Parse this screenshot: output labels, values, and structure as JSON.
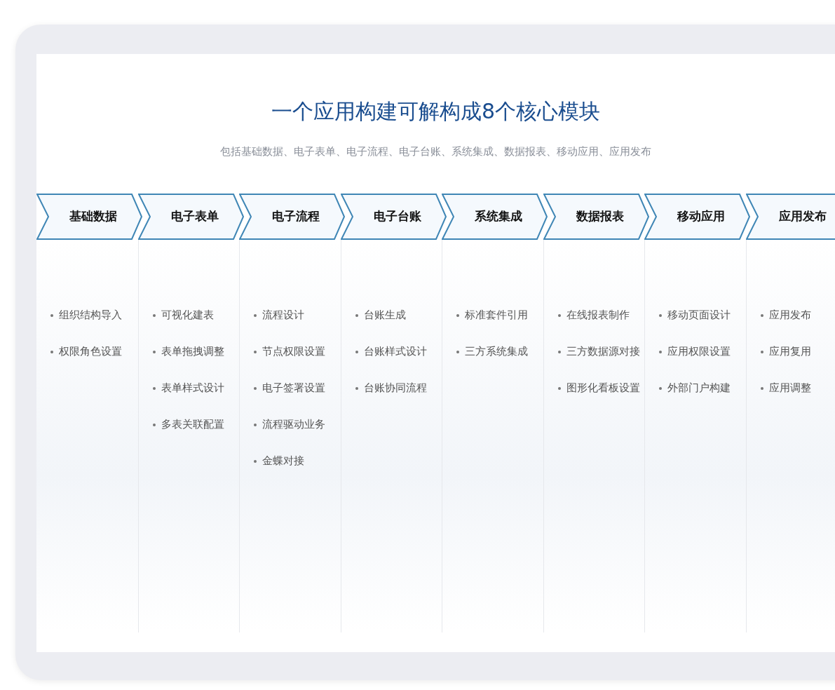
{
  "title": "一个应用构建可解构成8个核心模块",
  "subtitle": "包括基础数据、电子表单、电子流程、电子台账、系统集成、数据报表、移动应用、应用发布",
  "modules": [
    {
      "name": "基础数据",
      "items": [
        "组织结构导入",
        "权限角色设置"
      ]
    },
    {
      "name": "电子表单",
      "items": [
        "可视化建表",
        "表单拖拽调整",
        "表单样式设计",
        "多表关联配置"
      ]
    },
    {
      "name": "电子流程",
      "items": [
        "流程设计",
        "节点权限设置",
        "电子签署设置",
        "流程驱动业务",
        "金蝶对接"
      ]
    },
    {
      "name": "电子台账",
      "items": [
        "台账生成",
        "台账样式设计",
        "台账协同流程"
      ]
    },
    {
      "name": "系统集成",
      "items": [
        "标准套件引用",
        "三方系统集成"
      ]
    },
    {
      "name": "数据报表",
      "items": [
        "在线报表制作",
        "三方数据源对接",
        "图形化看板设置"
      ]
    },
    {
      "name": "移动应用",
      "items": [
        "移动页面设计",
        "应用权限设置",
        "外部门户构建"
      ]
    },
    {
      "name": "应用发布",
      "items": [
        "应用发布",
        "应用复用",
        "应用调整"
      ]
    }
  ]
}
